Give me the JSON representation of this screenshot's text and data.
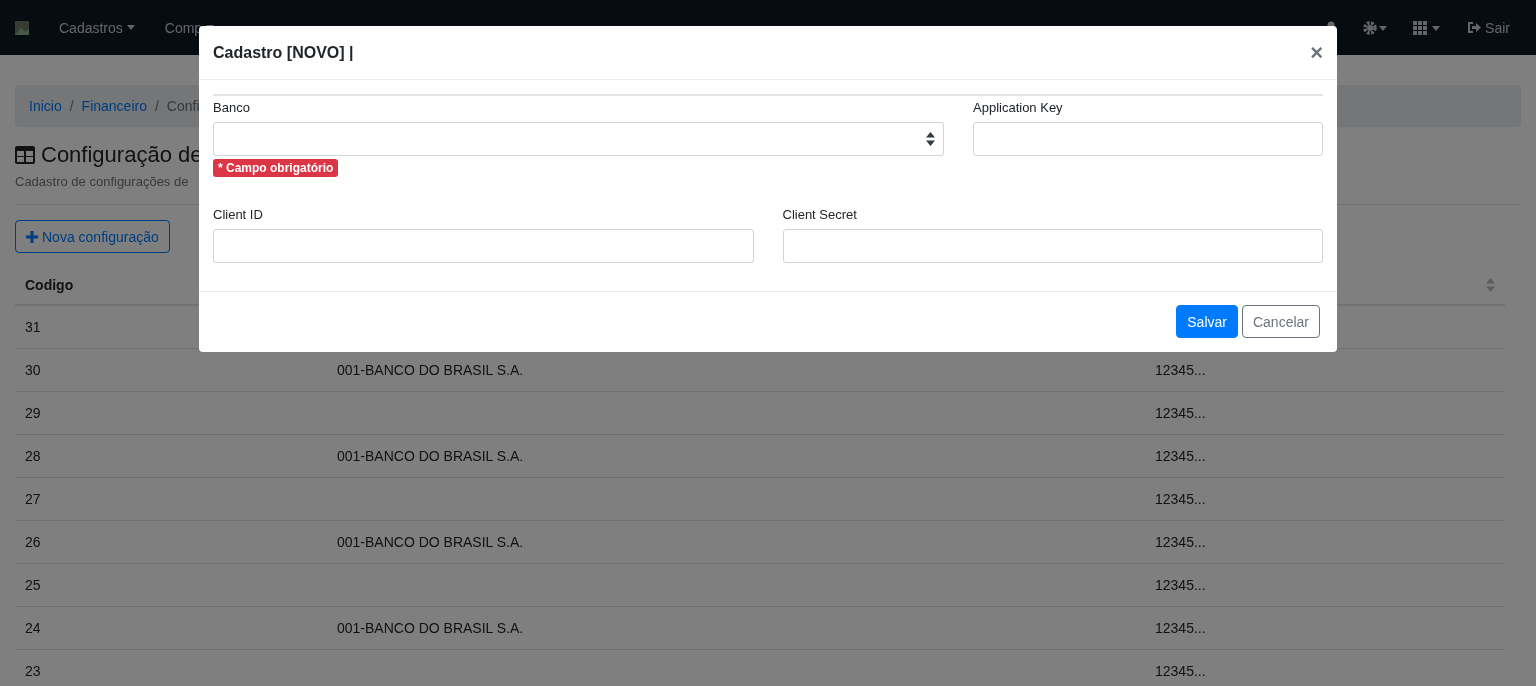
{
  "navbar": {
    "menu": [
      {
        "label": "Cadastros"
      },
      {
        "label": "Comp"
      }
    ],
    "logout": "Sair"
  },
  "breadcrumb": {
    "separator": "/",
    "items": [
      {
        "label": "Inicio",
        "link": true
      },
      {
        "label": "Financeiro",
        "link": true
      },
      {
        "label": "Confi",
        "link": false
      }
    ]
  },
  "page": {
    "title": "Configuração de",
    "subtitle": "Cadastro de configurações de",
    "new_button": "Nova configuração"
  },
  "table": {
    "columns": [
      "Codigo"
    ],
    "rows": [
      {
        "code": "31",
        "bank": "",
        "key": ""
      },
      {
        "code": "30",
        "bank": "001-BANCO DO BRASIL S.A.",
        "key": "12345..."
      },
      {
        "code": "29",
        "bank": "",
        "key": "12345..."
      },
      {
        "code": "28",
        "bank": "001-BANCO DO BRASIL S.A.",
        "key": "12345..."
      },
      {
        "code": "27",
        "bank": "",
        "key": "12345..."
      },
      {
        "code": "26",
        "bank": "001-BANCO DO BRASIL S.A.",
        "key": "12345..."
      },
      {
        "code": "25",
        "bank": "",
        "key": "12345..."
      },
      {
        "code": "24",
        "bank": "001-BANCO DO BRASIL S.A.",
        "key": "12345..."
      },
      {
        "code": "23",
        "bank": "",
        "key": "12345..."
      }
    ]
  },
  "modal": {
    "title": "Cadastro [NOVO] |",
    "close": "×",
    "fields": [
      {
        "label": "Banco",
        "kind": "select",
        "error": "* Campo obrigatório"
      },
      {
        "label": "Application Key",
        "kind": "text"
      },
      {
        "label": "Client ID",
        "kind": "text"
      },
      {
        "label": "Client Secret",
        "kind": "text"
      }
    ],
    "buttons": [
      {
        "label": "Salvar",
        "kind": "primary"
      },
      {
        "label": "Cancelar",
        "kind": "secondary"
      }
    ]
  }
}
